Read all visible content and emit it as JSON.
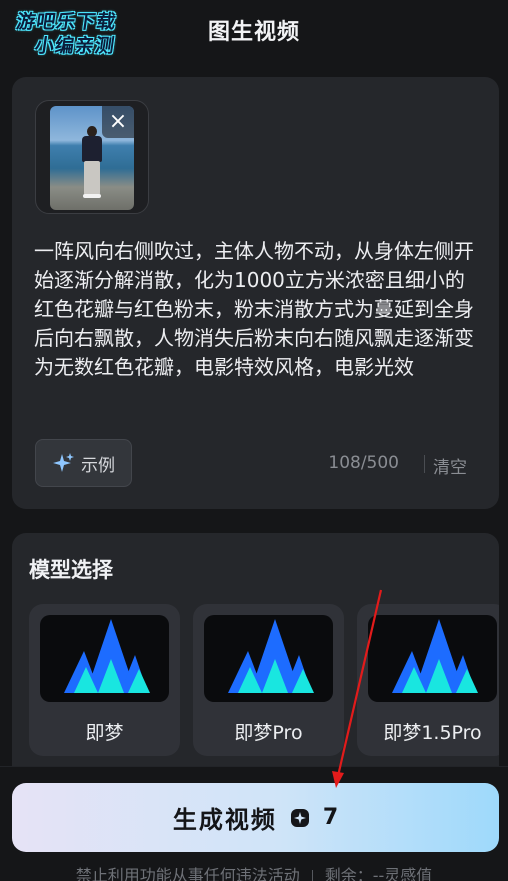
{
  "watermark": {
    "line1": "游吧乐下载",
    "line2": "小编亲测"
  },
  "header": {
    "title": "图生视频"
  },
  "prompt": {
    "image_close_icon": "close-icon",
    "text": "一阵风向右侧吹过，主体人物不动，从身体左侧开始逐渐分解消散，化为1000立方米浓密且细小的红色花瓣与红色粉末，粉末消散方式为蔓延到全身后向右飘散，人物消失后粉末向右随风飘走逐渐变为无数红色花瓣，电影特效风格，电影光效",
    "example_label": "示例",
    "example_icon": "sparkle-icon",
    "char_count": "108/500",
    "clear_label": "清空"
  },
  "models": {
    "heading": "模型选择",
    "items": [
      {
        "name": "即梦"
      },
      {
        "name": "即梦Pro"
      },
      {
        "name": "即梦1.5Pro"
      }
    ]
  },
  "generate": {
    "label": "生成视频",
    "credit_icon": "credit-icon",
    "credits": "7"
  },
  "footer": {
    "notice": "禁止利用功能从事任何违法活动",
    "balance": "剩余：--灵感值"
  },
  "colors": {
    "background": "#151618",
    "card": "#25272b",
    "annotation_arrow": "#e21b1b",
    "logo_blue": "#1d6cff",
    "logo_cyan": "#19e6e0"
  }
}
